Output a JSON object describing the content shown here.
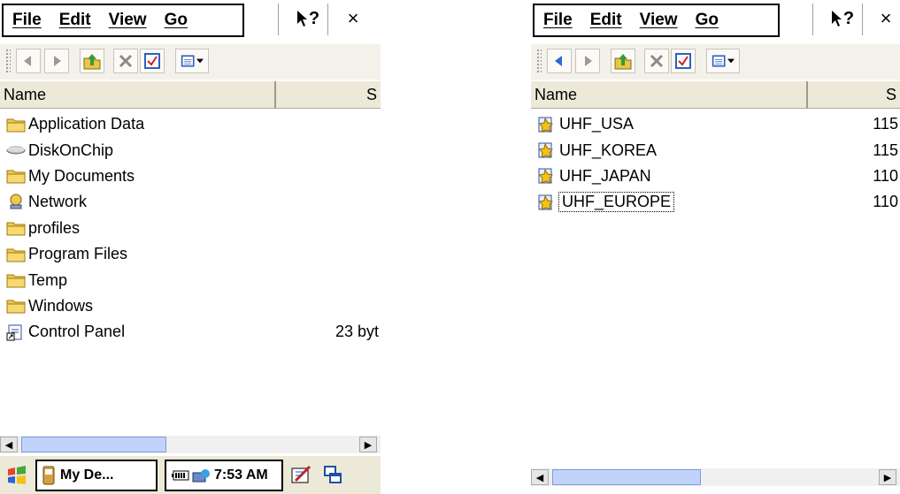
{
  "left": {
    "menu": [
      "File",
      "Edit",
      "View",
      "Go"
    ],
    "help_label": "?",
    "close_label": "×",
    "header": {
      "name": "Name",
      "size": "S"
    },
    "rows": [
      {
        "label": "Application Data",
        "icon": "folder-icon",
        "size": ""
      },
      {
        "label": "DiskOnChip",
        "icon": "drive-icon",
        "size": ""
      },
      {
        "label": "My Documents",
        "icon": "folder-icon",
        "size": ""
      },
      {
        "label": "Network",
        "icon": "network-icon",
        "size": ""
      },
      {
        "label": "profiles",
        "icon": "folder-icon",
        "size": ""
      },
      {
        "label": "Program Files",
        "icon": "folder-icon",
        "size": ""
      },
      {
        "label": "Temp",
        "icon": "folder-icon",
        "size": ""
      },
      {
        "label": "Windows",
        "icon": "folder-icon",
        "size": ""
      },
      {
        "label": "Control Panel",
        "icon": "shortcut-icon",
        "size": "23 byt"
      }
    ],
    "taskbar": {
      "app": "My De...",
      "time": "7:53 AM"
    }
  },
  "right": {
    "menu": [
      "File",
      "Edit",
      "View",
      "Go"
    ],
    "help_label": "?",
    "close_label": "×",
    "header": {
      "name": "Name",
      "size": "S"
    },
    "rows": [
      {
        "label": "UHF_USA",
        "icon": "settings-file-icon",
        "size": "115"
      },
      {
        "label": "UHF_KOREA",
        "icon": "settings-file-icon",
        "size": "115"
      },
      {
        "label": "UHF_JAPAN",
        "icon": "settings-file-icon",
        "size": "110"
      },
      {
        "label": "UHF_EUROPE",
        "icon": "settings-file-icon",
        "size": "110"
      }
    ]
  }
}
